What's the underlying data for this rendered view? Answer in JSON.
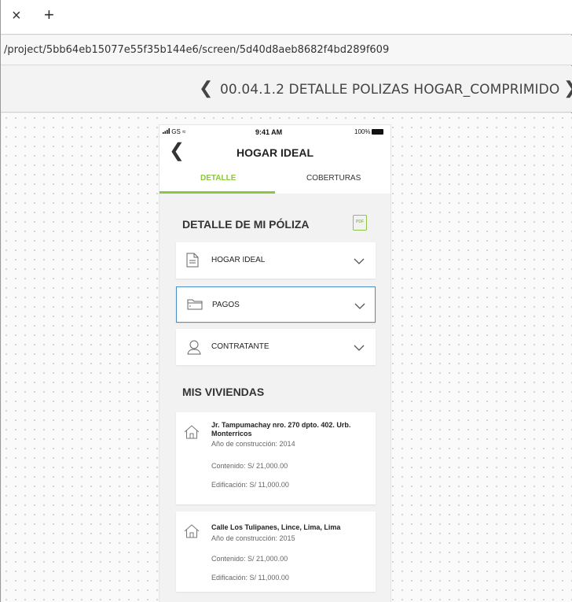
{
  "browser": {
    "close_label": "×",
    "new_tab_label": "+",
    "url": "/project/5bb64eb15077e55f35b144e6/screen/5d40d8aeb8682f4bd289f609"
  },
  "toolbar": {
    "prev_label": "❮",
    "title": "00.04.1.2 DETALLE POLIZAS HOGAR_COMPRIMIDO",
    "next_label": "❯"
  },
  "phone": {
    "status": {
      "carrier": "GS",
      "time": "9:41 AM",
      "battery": "100%"
    },
    "back_label": "❮",
    "title": "HOGAR IDEAL",
    "tabs": [
      {
        "label": "DETALLE",
        "active": true
      },
      {
        "label": "COBERTURAS",
        "active": false
      }
    ],
    "detail_section": {
      "title": "DETALLE DE MI PÓLIZA",
      "pdf_label": "PDF",
      "items": [
        {
          "label": "HOGAR IDEAL",
          "icon": "document-icon",
          "active": false
        },
        {
          "label": "PAGOS",
          "icon": "wallet-icon",
          "active": true
        },
        {
          "label": "CONTRATANTE",
          "icon": "user-icon",
          "active": false
        }
      ]
    },
    "homes_section": {
      "title": "MIS VIVIENDAS",
      "homes": [
        {
          "address": "Jr. Tampumachay nro. 270 dpto. 402. Urb. Monterricos",
          "year": "Año de construcción: 2014",
          "contenido": "Contenido:  S/ 21,000.00",
          "edificacion": "Edificación: S/ 11,000.00"
        },
        {
          "address": "Calle Los Tulipanes, Lince, Lima, Lima",
          "year": "Año de construcción: 2015",
          "contenido": "Contenido:  S/ 21,000.00",
          "edificacion": "Edificación: S/ 11,000.00"
        }
      ]
    }
  },
  "colors": {
    "accent_green": "#8cc63e",
    "active_border": "#4a90c8"
  }
}
